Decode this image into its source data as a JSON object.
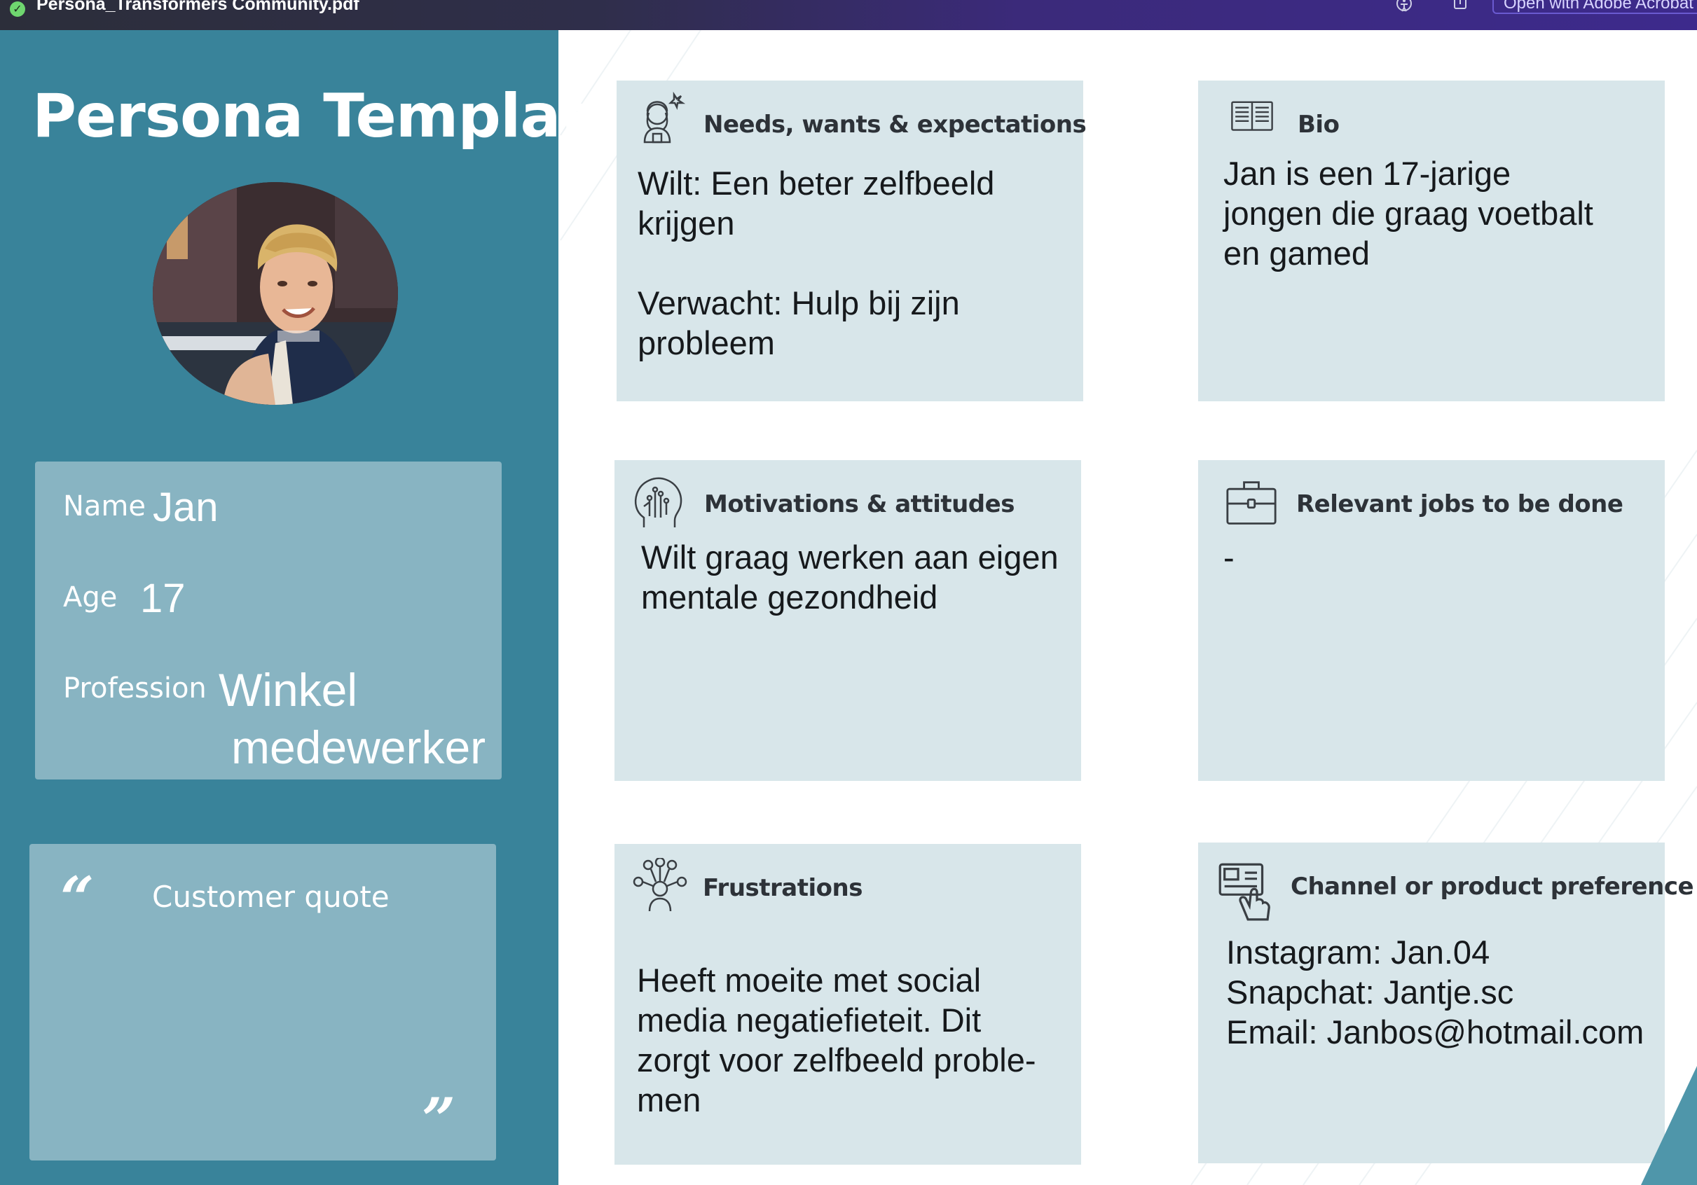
{
  "window": {
    "filename": "Persona_Transformers Community.pdf",
    "open_button": "Open with Adobe Acrobat",
    "doc_icon": "pdf-check-icon",
    "toolbar_icons": [
      "accessibility-icon",
      "share-icon"
    ]
  },
  "colors": {
    "sidebar": "#39839a",
    "sidebar_card": "#88b4c2",
    "content_card": "#d8e6ea",
    "text_dark": "#16191c"
  },
  "sidebar": {
    "title": "Persona Template",
    "photo_icon": "persona-photo",
    "name_label": "Name",
    "name_value": "Jan",
    "age_label": "Age",
    "age_value": "17",
    "profession_label": "Profession",
    "profession_value_line1": "Winkel",
    "profession_value_line2": "medewerker",
    "quote_label": "Customer quote",
    "quote_open": "“",
    "quote_close": "”"
  },
  "cards": {
    "needs": {
      "title": "Needs, wants & expectations",
      "icon": "woman-thinking-icon",
      "body": "Wilt: Een beter zelfbeeld\nkrijgen\n\nVerwacht: Hulp bij zijn\nprobleem"
    },
    "bio": {
      "title": "Bio",
      "icon": "open-book-icon",
      "body": "Jan is een 17-jarige\njongen die graag voetbalt\nen gamed"
    },
    "motivations": {
      "title": "Motivations & attitudes",
      "icon": "head-circuit-icon",
      "body": "Wilt graag werken aan eigen\nmentale gezondheid"
    },
    "jobs": {
      "title": "Relevant jobs to be done",
      "icon": "briefcase-icon",
      "body": "-"
    },
    "frustrations": {
      "title": "Frustrations",
      "icon": "person-network-icon",
      "body": "Heeft moeite met social\nmedia negatiefieteit. Dit\nzorgt voor zelfbeeld proble-\nmen"
    },
    "channel": {
      "title": "Channel or product preference",
      "icon": "touch-screen-icon",
      "body": "Instagram: Jan.04\nSnapchat: Jantje.sc\nEmail: Janbos@hotmail.com"
    }
  }
}
